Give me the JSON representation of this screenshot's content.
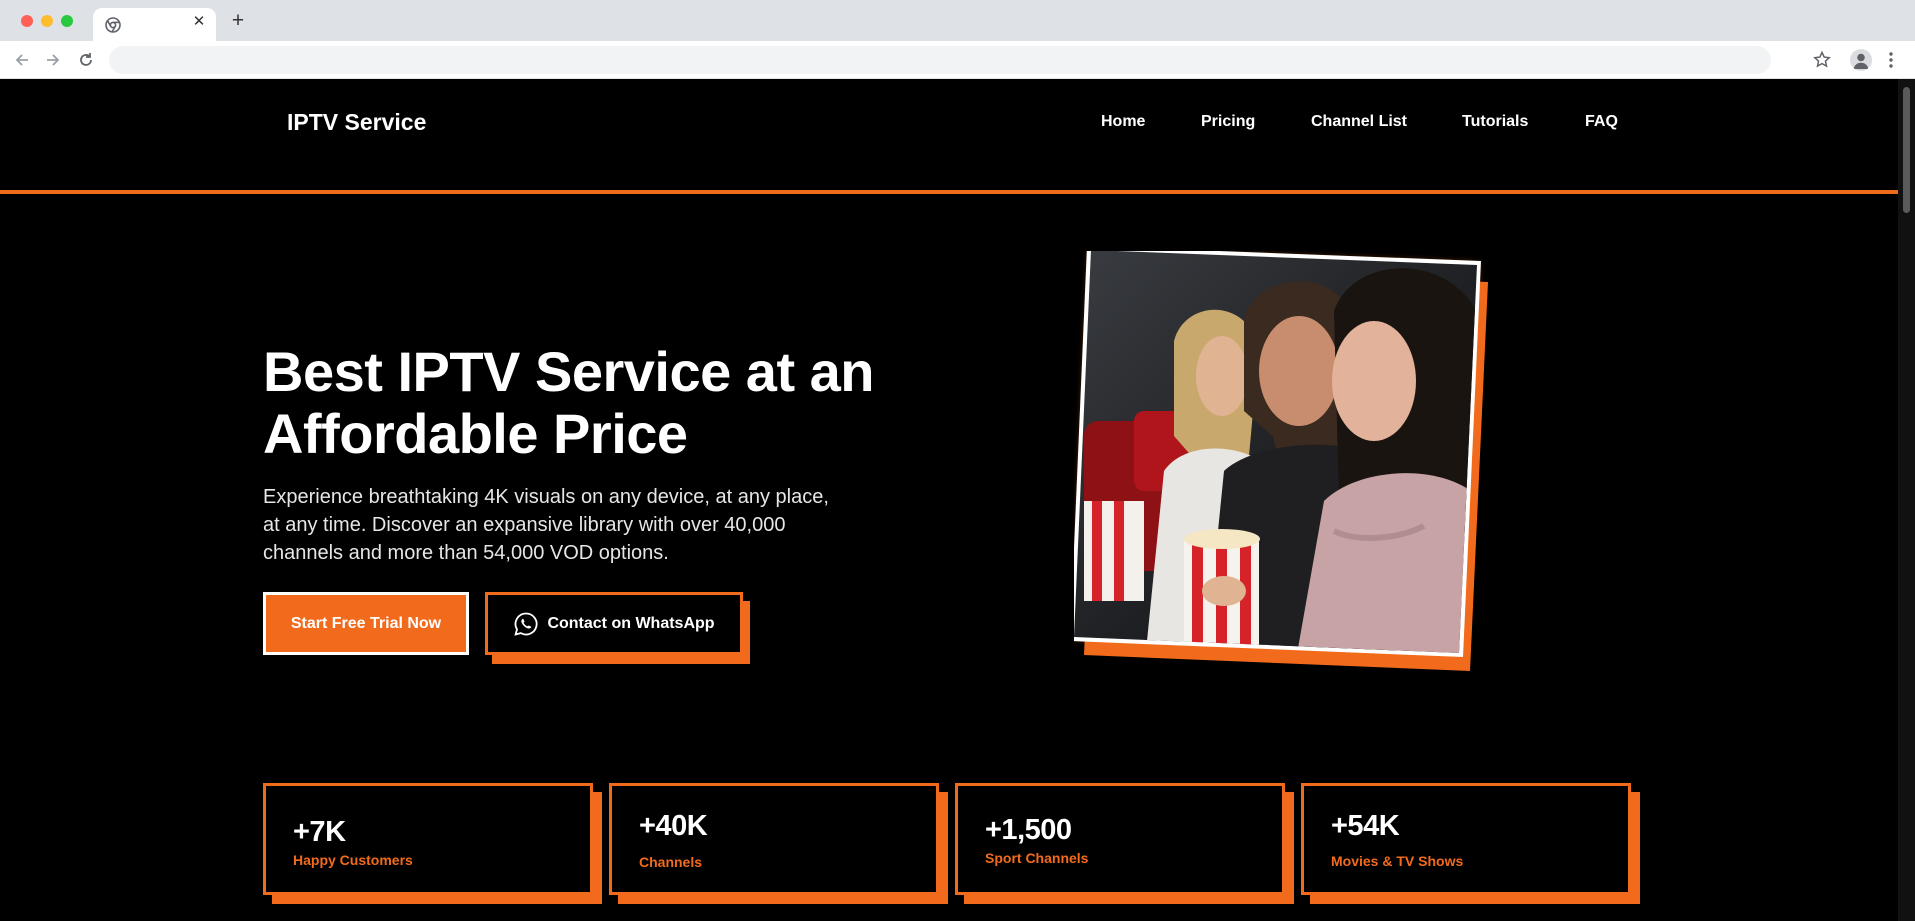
{
  "browser": {
    "tab_title": "",
    "url": ""
  },
  "header": {
    "brand": "IPTV Service",
    "nav": [
      "Home",
      "Pricing",
      "Channel List",
      "Tutorials",
      "FAQ"
    ]
  },
  "hero": {
    "headline": "Best IPTV Service at an Affordable Price",
    "lead": "Experience breathtaking 4K visuals on any device, at any place, at any time. Discover an expansive library with over 40,000 channels and more than 54,000 VOD options.",
    "primary_cta": "Start Free Trial Now",
    "secondary_cta": "Contact on WhatsApp",
    "image_icon": "cinema-audience-photo"
  },
  "stats": [
    {
      "value": "+7K",
      "label": "Happy Customers"
    },
    {
      "value": "+40K",
      "label": "Channels"
    },
    {
      "value": "+1,500",
      "label": "Sport Channels"
    },
    {
      "value": "+54K",
      "label": "Movies & TV Shows"
    }
  ],
  "colors": {
    "accent": "#f26b1d",
    "background": "#000000",
    "text": "#ffffff"
  }
}
